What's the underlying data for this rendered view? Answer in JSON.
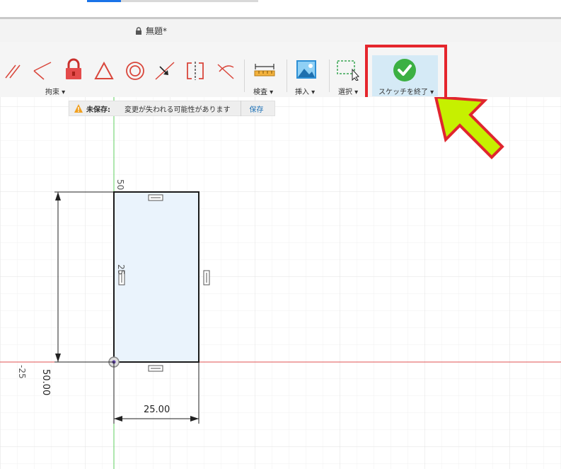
{
  "document": {
    "title": "無題*"
  },
  "toolbar": {
    "groups": {
      "constraint": "拘束",
      "inspect": "検査",
      "insert": "挿入",
      "select": "選択",
      "finish_sketch": "スケッチを終了"
    }
  },
  "notice": {
    "label": "未保存:",
    "message": "変更が失われる可能性があります",
    "save_link": "保存"
  },
  "sketch": {
    "height_dimension": "50.00",
    "width_dimension": "25.00",
    "axis_label_top": "50",
    "axis_label_mid": "25",
    "axis_label_left": "-25"
  },
  "colors": {
    "accent_blue": "#1a73e8",
    "highlight_red": "#e5262d",
    "arrow_green": "#c6f000",
    "check_green": "#3cb043",
    "profile_fill": "#eaf3fc",
    "x_axis": "#e05050",
    "y_axis": "#5fcf5f"
  },
  "icons": [
    "lock-icon",
    "tangent-icon",
    "perpendicular-icon",
    "constraint-lock-icon",
    "triangle-icon",
    "concentric-icon",
    "midpoint-icon",
    "symmetry-icon",
    "curvature-icon",
    "measure-icon",
    "insert-image-icon",
    "select-icon",
    "checkmark-icon",
    "warning-icon",
    "callout-arrow"
  ]
}
